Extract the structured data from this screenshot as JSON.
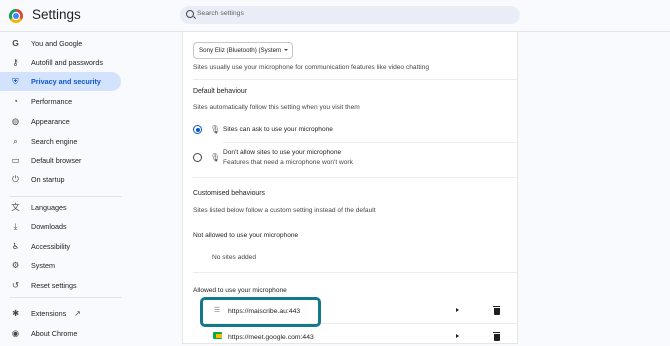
{
  "app": {
    "title": "Settings",
    "search_placeholder": "Search settings"
  },
  "sidebar": {
    "items": [
      {
        "label": "You and Google",
        "icon": "google-g-icon",
        "active": false
      },
      {
        "label": "Autofill and passwords",
        "icon": "key-icon",
        "active": false
      },
      {
        "label": "Privacy and security",
        "icon": "shield-icon",
        "active": true
      },
      {
        "label": "Performance",
        "icon": "speedometer-icon",
        "active": false
      },
      {
        "label": "Appearance",
        "icon": "palette-icon",
        "active": false
      },
      {
        "label": "Search engine",
        "icon": "search-icon",
        "active": false
      },
      {
        "label": "Default browser",
        "icon": "browser-window-icon",
        "active": false
      },
      {
        "label": "On startup",
        "icon": "power-icon",
        "active": false
      },
      {
        "label": "Languages",
        "icon": "translate-icon",
        "active": false
      },
      {
        "label": "Downloads",
        "icon": "download-icon",
        "active": false
      },
      {
        "label": "Accessibility",
        "icon": "accessibility-icon",
        "active": false
      },
      {
        "label": "System",
        "icon": "wrench-icon",
        "active": false
      },
      {
        "label": "Reset settings",
        "icon": "reset-icon",
        "active": false
      },
      {
        "label": "Extensions",
        "icon": "puzzle-icon",
        "active": false
      },
      {
        "label": "About Chrome",
        "icon": "chrome-icon",
        "active": false
      }
    ]
  },
  "main": {
    "mic_select_value": "Sony Eliz (Bluetooth) (System",
    "mic_select_desc": "Sites usually use your microphone for communication features like video chatting",
    "default_behaviour": {
      "heading": "Default behaviour",
      "desc": "Sites automatically follow this setting when you visit them",
      "options": [
        {
          "label": "Sites can ask to use your microphone",
          "selected": true
        },
        {
          "label": "Don't allow sites to use your microphone",
          "sub": "Features that need a microphone won't work",
          "selected": false
        }
      ]
    },
    "customised": {
      "heading": "Customised behaviours",
      "desc": "Sites listed below follow a custom setting instead of the default",
      "not_allowed_heading": "Not allowed to use your microphone",
      "not_allowed_empty": "No sites added",
      "allowed_heading": "Allowed to use your microphone",
      "allowed_sites": [
        {
          "url": "https://maiscribe.au:443",
          "icon": "globe-icon"
        },
        {
          "url": "https://meet.google.com:443",
          "icon": "google-meet-icon"
        }
      ]
    }
  },
  "colors": {
    "accent": "#0b57d0",
    "active_bg": "#d3e3fd",
    "highlight_border": "#13798a"
  }
}
